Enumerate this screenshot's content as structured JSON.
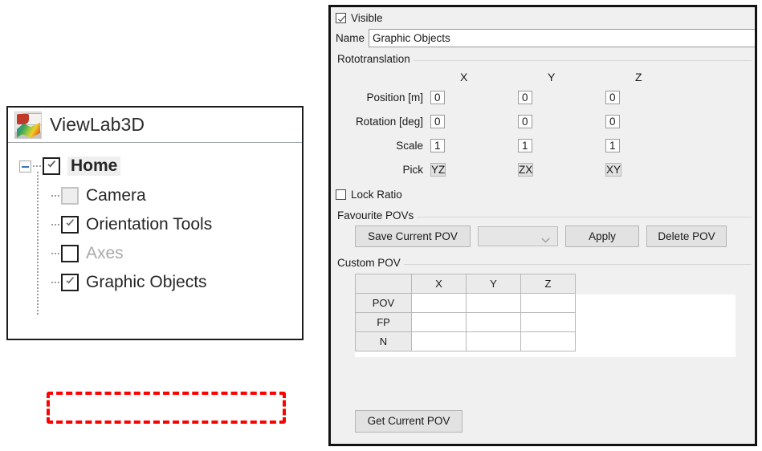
{
  "app": {
    "title": "ViewLab3D",
    "logo_icon": "viewlab3d-logo-icon"
  },
  "tree": {
    "root": {
      "label": "Home",
      "checked": true,
      "expander_icon": "minus-expander-icon"
    },
    "children": [
      {
        "label": "Camera",
        "checked": false,
        "state": "disabled"
      },
      {
        "label": "Orientation Tools",
        "checked": true,
        "state": "normal"
      },
      {
        "label": "Axes",
        "checked": false,
        "state": "dimmed"
      },
      {
        "label": "Graphic Objects",
        "checked": true,
        "state": "normal",
        "highlighted": true
      }
    ],
    "highlight_color": "#ff0000"
  },
  "properties": {
    "visible": {
      "label": "Visible",
      "checked": true
    },
    "name": {
      "label": "Name",
      "value": "Graphic Objects"
    },
    "rototranslation": {
      "title": "Rototranslation",
      "axes": [
        "X",
        "Y",
        "Z"
      ],
      "rows": [
        {
          "label": "Position [m]",
          "values": [
            "0",
            "0",
            "0"
          ]
        },
        {
          "label": "Rotation [deg]",
          "values": [
            "0",
            "0",
            "0"
          ]
        },
        {
          "label": "Scale",
          "values": [
            "1",
            "1",
            "1"
          ]
        }
      ],
      "pick": {
        "label": "Pick",
        "buttons": [
          "YZ",
          "ZX",
          "XY"
        ]
      },
      "lock_ratio": {
        "label": "Lock Ratio",
        "checked": false
      }
    },
    "favourite_povs": {
      "title": "Favourite POVs",
      "save_label": "Save Current POV",
      "combo_value": "",
      "combo_icon": "chevron-down-icon",
      "apply_label": "Apply",
      "delete_label": "Delete POV"
    },
    "custom_pov": {
      "title": "Custom POV",
      "corner_header": "",
      "columns": [
        "X",
        "Y",
        "Z"
      ],
      "rows": [
        {
          "header": "POV",
          "cells": [
            "",
            "",
            ""
          ]
        },
        {
          "header": "FP",
          "cells": [
            "",
            "",
            ""
          ]
        },
        {
          "header": "N",
          "cells": [
            "",
            "",
            ""
          ]
        }
      ],
      "get_label": "Get Current POV"
    }
  }
}
